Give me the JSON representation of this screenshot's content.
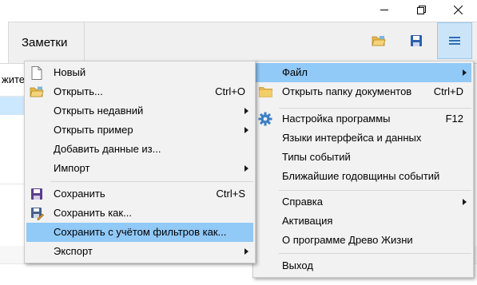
{
  "window": {
    "minimize_icon": "minimize-icon",
    "restore_icon": "restore-icon",
    "close_icon": "close-icon"
  },
  "toolbar": {
    "tab_notes": "Заметки",
    "open_folder_icon": "open-folder-icon",
    "save_icon": "save-icon",
    "menu_icon": "hamburger-icon"
  },
  "table": {
    "column_header_partial": "жите"
  },
  "main_menu": {
    "items": [
      {
        "label": "Файл",
        "shortcut": "",
        "submenu": true,
        "highlighted": true,
        "icon": ""
      },
      {
        "label": "Открыть папку документов",
        "shortcut": "Ctrl+D",
        "submenu": false,
        "icon": "folder-icon"
      },
      {
        "label": "Настройка программы",
        "shortcut": "F12",
        "submenu": false,
        "icon": "gear-icon"
      },
      {
        "label": "Языки интерфейса и данных",
        "shortcut": "",
        "submenu": false,
        "icon": ""
      },
      {
        "label": "Типы событий",
        "shortcut": "",
        "submenu": false,
        "icon": ""
      },
      {
        "label": "Ближайшие годовщины событий",
        "shortcut": "",
        "submenu": false,
        "icon": ""
      },
      {
        "label": "Справка",
        "shortcut": "",
        "submenu": true,
        "icon": ""
      },
      {
        "label": "Активация",
        "shortcut": "",
        "submenu": false,
        "icon": ""
      },
      {
        "label": "О программе Древо Жизни",
        "shortcut": "",
        "submenu": false,
        "icon": ""
      },
      {
        "label": "Выход",
        "shortcut": "",
        "submenu": false,
        "icon": ""
      }
    ]
  },
  "file_menu": {
    "items": [
      {
        "label": "Новый",
        "shortcut": "",
        "submenu": false,
        "icon": "new-document-icon"
      },
      {
        "label": "Открыть...",
        "shortcut": "Ctrl+O",
        "submenu": false,
        "icon": "open-folder-icon"
      },
      {
        "label": "Открыть недавний",
        "shortcut": "",
        "submenu": true,
        "icon": ""
      },
      {
        "label": "Открыть пример",
        "shortcut": "",
        "submenu": true,
        "icon": ""
      },
      {
        "label": "Добавить данные из...",
        "shortcut": "",
        "submenu": false,
        "icon": ""
      },
      {
        "label": "Импорт",
        "shortcut": "",
        "submenu": true,
        "icon": ""
      },
      {
        "label": "Сохранить",
        "shortcut": "Ctrl+S",
        "submenu": false,
        "icon": "save-icon"
      },
      {
        "label": "Сохранить как...",
        "shortcut": "",
        "submenu": false,
        "icon": "save-as-icon"
      },
      {
        "label": "Сохранить с учётом фильтров как...",
        "shortcut": "",
        "submenu": false,
        "highlighted": true,
        "icon": ""
      },
      {
        "label": "Экспорт",
        "shortcut": "",
        "submenu": true,
        "icon": ""
      }
    ]
  },
  "colors": {
    "highlight": "#91c9f7",
    "menu_bg": "#f2f2f2",
    "toolbar_bg": "#f0f0f0",
    "active_button": "#cce4f7",
    "selected_row": "#cce8ff",
    "save_icon": "#5a3d8a",
    "folder_icon": "#e8b84a",
    "gear_icon": "#3c7fc4"
  }
}
